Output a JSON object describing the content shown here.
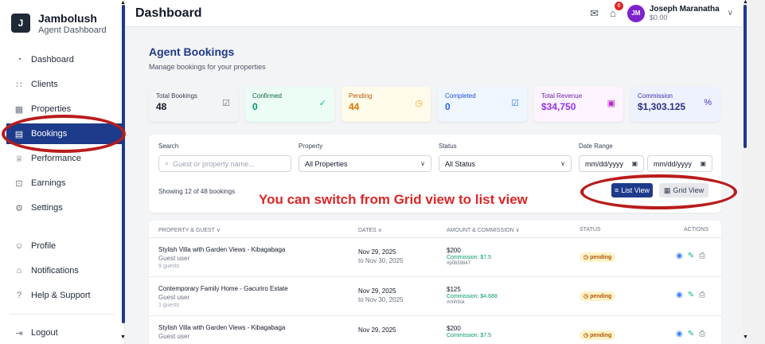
{
  "brand": {
    "name": "Jambolush",
    "subtitle": "Agent Dashboard",
    "logo_icon": "brand-logo-icon"
  },
  "sidebar": {
    "items": [
      {
        "label": "Dashboard",
        "icon": "dashboard-icon",
        "glyph": "◔"
      },
      {
        "label": "Clients",
        "icon": "users-icon",
        "glyph": "👥"
      },
      {
        "label": "Properties",
        "icon": "building-icon",
        "glyph": "▦"
      },
      {
        "label": "Bookings",
        "icon": "calendar-icon",
        "glyph": "▤",
        "active": true
      },
      {
        "label": "Performance",
        "icon": "trophy-icon",
        "glyph": "♕"
      },
      {
        "label": "Earnings",
        "icon": "money-icon",
        "glyph": "⊡"
      },
      {
        "label": "Settings",
        "icon": "gear-icon",
        "glyph": "⚙"
      }
    ],
    "bottom_items": [
      {
        "label": "Profile",
        "icon": "user-icon",
        "glyph": "⍝"
      },
      {
        "label": "Notifications",
        "icon": "bell-icon",
        "glyph": "🔔"
      },
      {
        "label": "Help & Support",
        "icon": "help-icon",
        "glyph": "?"
      }
    ],
    "logout": {
      "label": "Logout",
      "icon": "logout-icon",
      "glyph": "⇥"
    }
  },
  "header": {
    "title": "Dashboard",
    "notification_count": "6",
    "user": {
      "initials": "JM",
      "name": "Joseph Maranatha",
      "balance": "$0.00"
    }
  },
  "page": {
    "title": "Agent Bookings",
    "subtitle": "Manage bookings for your properties"
  },
  "stats": [
    {
      "label": "Total Bookings",
      "value": "48",
      "icon": "checkbox-icon",
      "glyph": "☑"
    },
    {
      "label": "Confirmed",
      "value": "0",
      "icon": "check-circle-icon",
      "glyph": "✓"
    },
    {
      "label": "Pending",
      "value": "44",
      "icon": "clock-icon",
      "glyph": "◷"
    },
    {
      "label": "Completed",
      "value": "0",
      "icon": "check-square-icon",
      "glyph": "☑"
    },
    {
      "label": "Total Revenue",
      "value": "$34,750",
      "icon": "cash-icon",
      "glyph": "▣"
    },
    {
      "label": "Commission",
      "value": "$1,303.125",
      "icon": "percent-icon",
      "glyph": "%"
    }
  ],
  "filters": {
    "search_label": "Search",
    "search_placeholder": "Guest or property name...",
    "property_label": "Property",
    "property_value": "All Properties",
    "status_label": "Status",
    "status_value": "All Status",
    "date_label": "Date Range",
    "date_from": "mm/dd/yyyy",
    "date_to": "mm/dd/yyyy",
    "showing": "Showing 12 of 48 bookings",
    "list_view": "List View",
    "grid_view": "Grid View"
  },
  "annotation": {
    "text": "You can switch from Grid view to list view",
    "color": "#dc2626"
  },
  "table": {
    "headers": [
      "PROPERTY & GUEST ∨",
      "DATES ∨",
      "AMOUNT & COMMISSION ∨",
      "STATUS",
      "ACTIONS"
    ],
    "rows": [
      {
        "property": "Stylish Villa with Garden Views - Kibagabaga",
        "guest": "Guest user",
        "guests": "9 guests",
        "from": "Nov 29, 2025",
        "to": "to Nov 30, 2025",
        "amount": "$200",
        "commission": "Commission: $7.5",
        "ref": "#p0b59847",
        "status": "pending"
      },
      {
        "property": "Contemporary Family Home - Gacuriro Estate",
        "guest": "Guest user",
        "guests": "1 guests",
        "from": "Nov 29, 2025",
        "to": "to Nov 30, 2025",
        "amount": "$125",
        "commission": "Commission: $4.688",
        "ref": "#rinh9sk",
        "status": "pending"
      },
      {
        "property": "Stylish Villa with Garden Views - Kibagabaga",
        "guest": "Guest user",
        "guests": "",
        "from": "Nov 29, 2025",
        "to": "",
        "amount": "$200",
        "commission": "Commission: $7.5",
        "ref": "",
        "status": "pending"
      }
    ]
  }
}
